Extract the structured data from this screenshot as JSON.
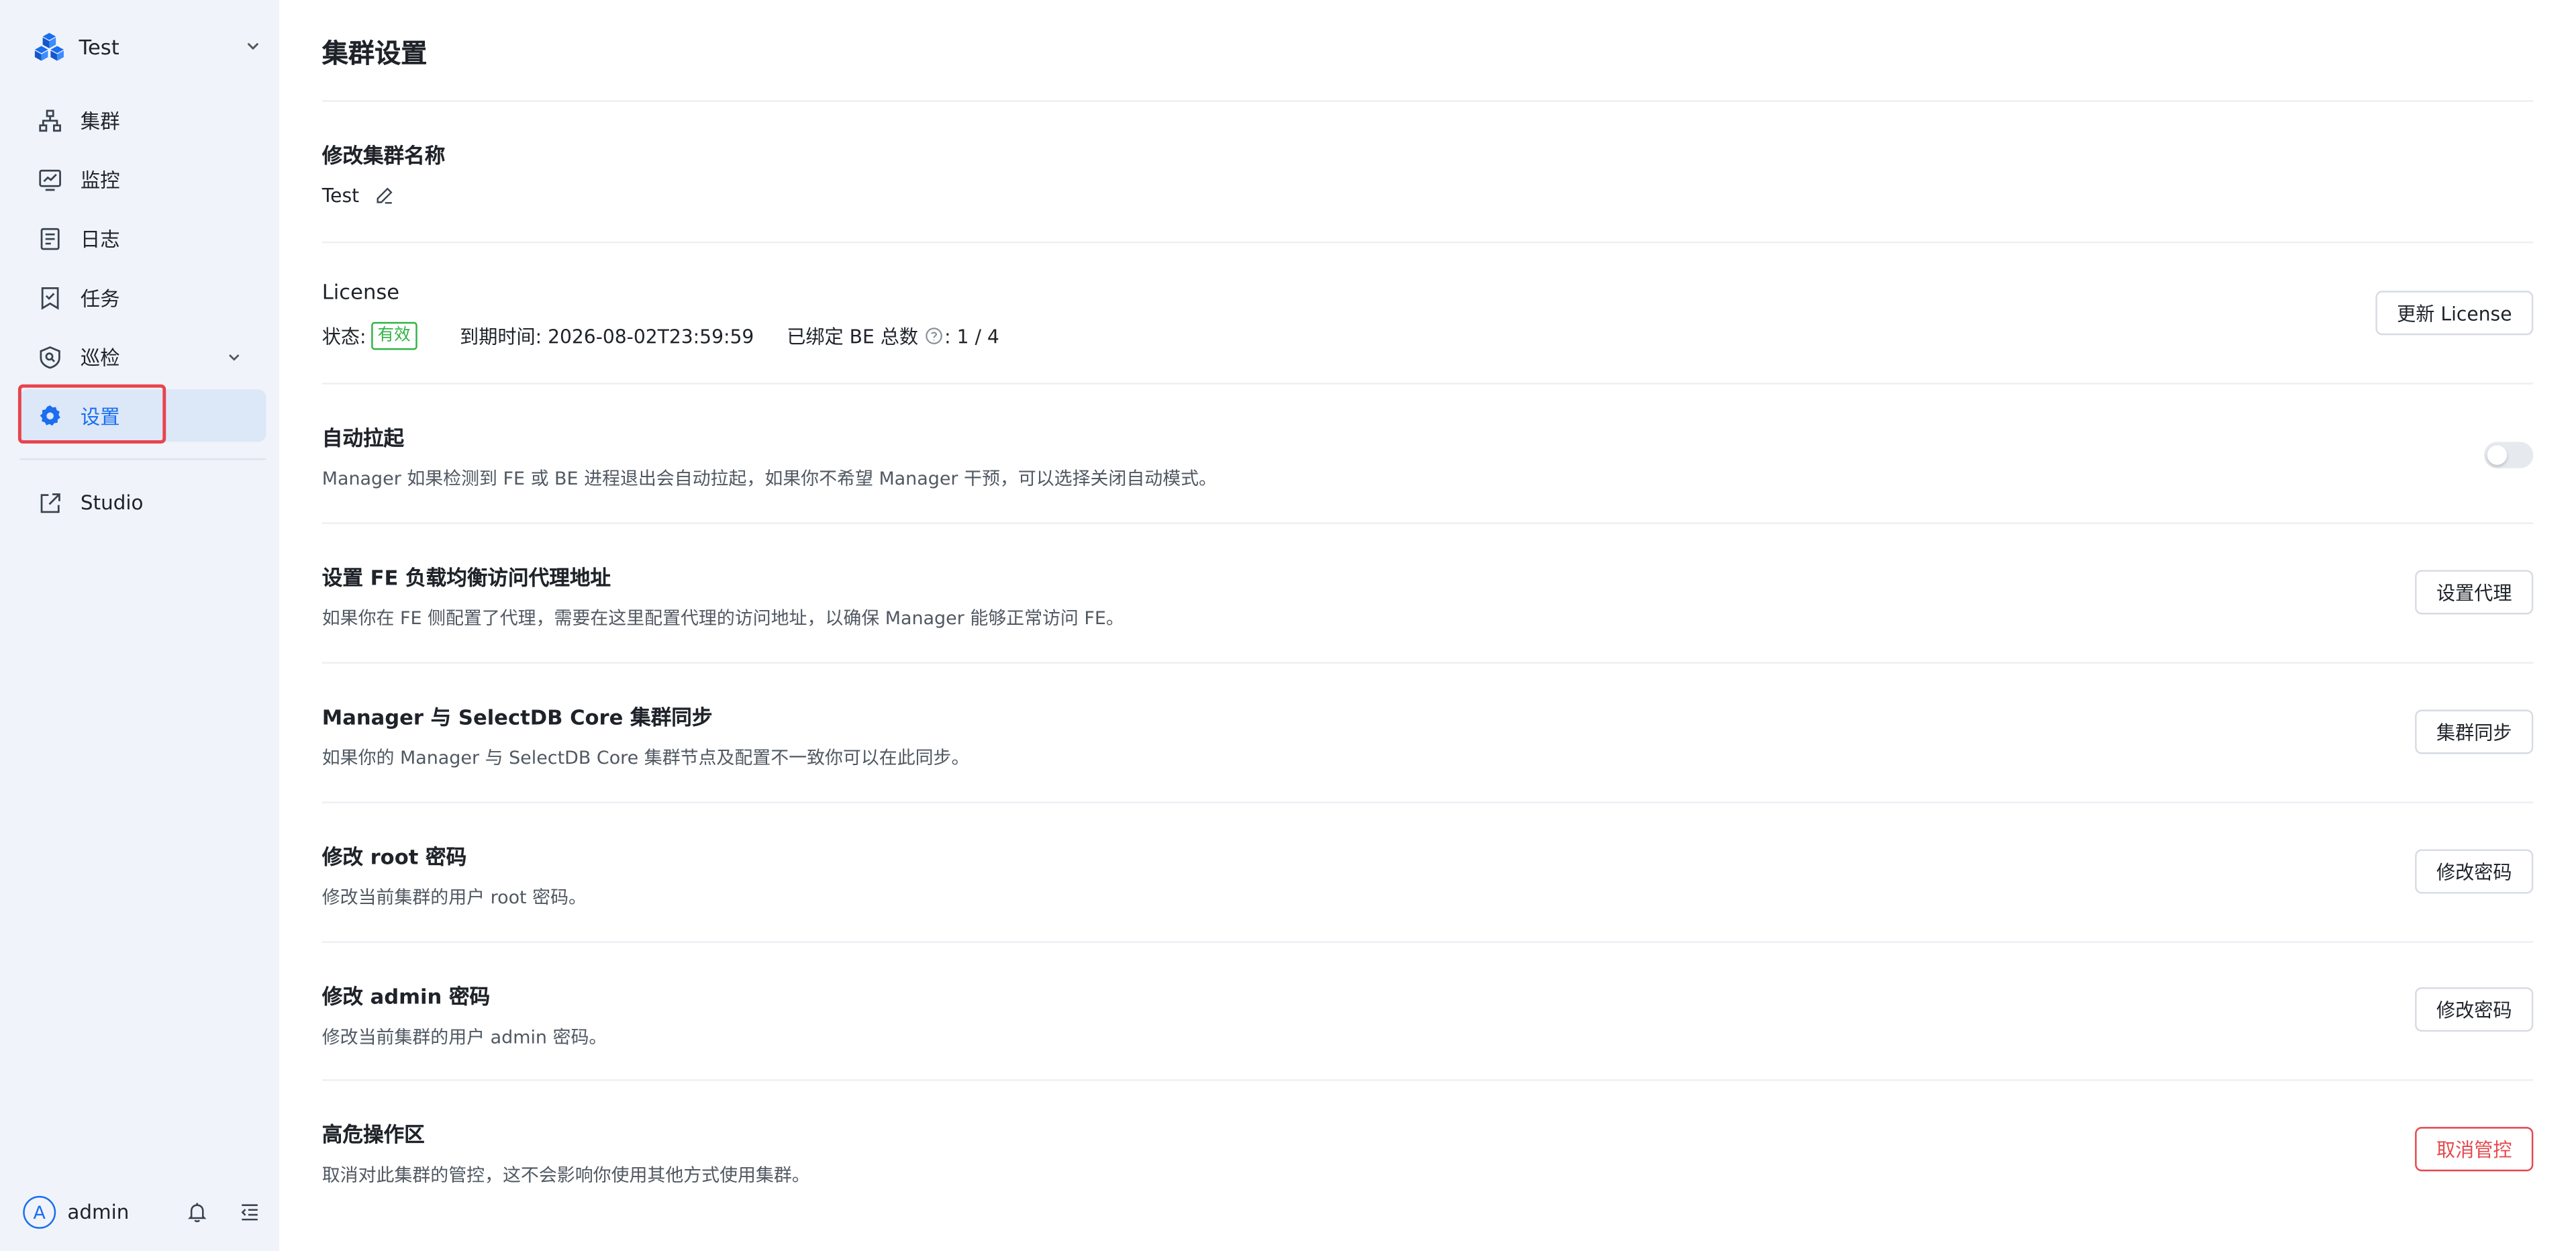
{
  "sidebar": {
    "brand": {
      "name": "Test"
    },
    "items": [
      {
        "label": "集群",
        "icon": "cluster-icon"
      },
      {
        "label": "监控",
        "icon": "monitor-icon"
      },
      {
        "label": "日志",
        "icon": "log-icon"
      },
      {
        "label": "任务",
        "icon": "task-icon"
      },
      {
        "label": "巡检",
        "icon": "inspection-icon"
      },
      {
        "label": "设置",
        "icon": "settings-icon",
        "active": true
      },
      {
        "label": "Studio",
        "icon": "external-link-icon"
      }
    ],
    "user": {
      "avatar": "A",
      "name": "admin"
    }
  },
  "page": {
    "title": "集群设置"
  },
  "sections": {
    "rename": {
      "title": "修改集群名称",
      "value": "Test"
    },
    "license": {
      "title": "License",
      "status_label": "状态:",
      "status_value": "有效",
      "expire": "到期时间: 2026-08-02T23:59:59",
      "bound_label": "已绑定 BE 总数",
      "bound_value": ": 1 / 4",
      "button": "更新 License"
    },
    "auto_restart": {
      "title": "自动拉起",
      "desc": "Manager 如果检测到 FE 或 BE 进程退出会自动拉起，如果你不希望 Manager 干预，可以选择关闭自动模式。",
      "enabled": false
    },
    "proxy": {
      "title": "设置 FE 负载均衡访问代理地址",
      "desc": "如果你在 FE 侧配置了代理，需要在这里配置代理的访问地址，以确保 Manager 能够正常访问 FE。",
      "button": "设置代理"
    },
    "sync": {
      "title": "Manager 与 SelectDB Core 集群同步",
      "desc": "如果你的 Manager 与 SelectDB Core 集群节点及配置不一致你可以在此同步。",
      "button": "集群同步"
    },
    "root_pwd": {
      "title": "修改 root 密码",
      "desc": "修改当前集群的用户 root 密码。",
      "button": "修改密码"
    },
    "admin_pwd": {
      "title": "修改 admin 密码",
      "desc": "修改当前集群的用户 admin 密码。",
      "button": "修改密码"
    },
    "danger": {
      "title": "高危操作区",
      "desc": "取消对此集群的管控，这不会影响你使用其他方式使用集群。",
      "button": "取消管控"
    }
  },
  "colors": {
    "accent": "#1a6ef0",
    "sidebar_bg": "#f0f4fa",
    "success": "#2fb344",
    "danger": "#e5484d",
    "highlight_box": "#e8434c"
  }
}
